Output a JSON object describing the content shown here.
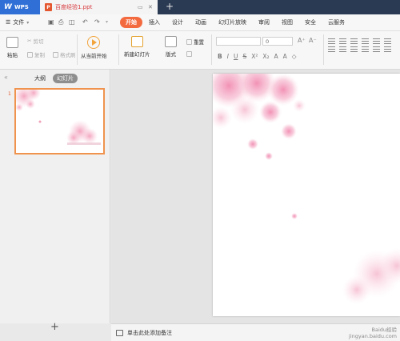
{
  "titlebar": {
    "app_name": "WPS",
    "document_tab": "百度经验1.ppt",
    "new_tab_symbol": "+"
  },
  "menubar": {
    "file_label": "文件",
    "items": [
      "开始",
      "插入",
      "设计",
      "动画",
      "幻灯片放映",
      "审阅",
      "视图",
      "安全",
      "云服务"
    ],
    "active_item": "开始",
    "accent_color": "#f46a3f"
  },
  "ribbon": {
    "paste_label": "粘贴",
    "cut_label": "剪切",
    "copy_label": "复制",
    "format_painter_label": "格式刷",
    "play_from_start_label": "从当前开始",
    "new_slide_label": "新建幻灯片",
    "layout_label": "版式",
    "reset_label": "重置",
    "font_size_value": "0"
  },
  "leftpanel": {
    "outline_tab": "大纲",
    "slides_tab": "幻灯片",
    "slide_number": "1",
    "add_symbol": "+"
  },
  "notes": {
    "placeholder": "单击此处添加备注"
  },
  "watermark": {
    "line1": "Baidu经验",
    "line2": "jingyan.baidu.com"
  }
}
